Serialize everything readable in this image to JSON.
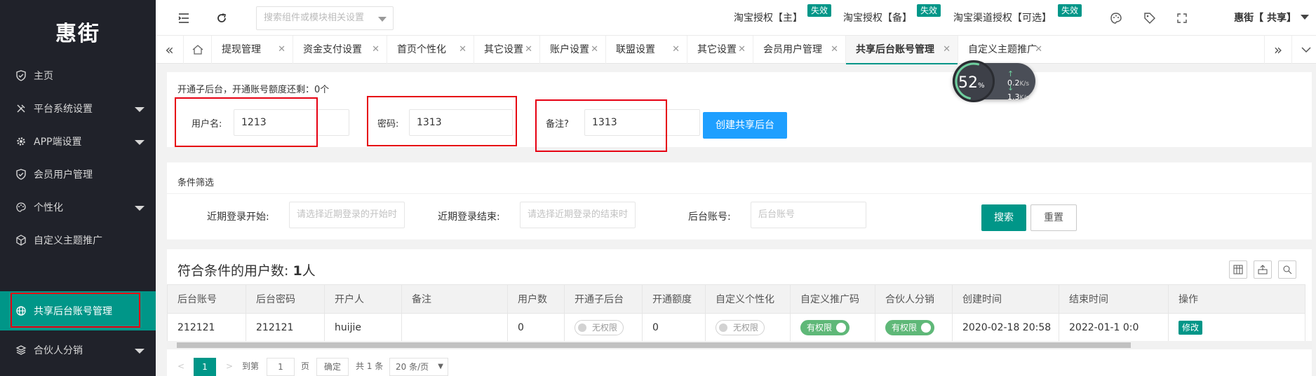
{
  "app": {
    "logo": "惠街"
  },
  "sidebar": {
    "items": [
      {
        "label": "主页",
        "icon": "shield-icon",
        "has_caret": false
      },
      {
        "label": "平台系统设置",
        "icon": "tools-icon",
        "has_caret": true
      },
      {
        "label": "APP端设置",
        "icon": "gear-icon",
        "has_caret": true
      },
      {
        "label": "会员用户管理",
        "icon": "shield-icon",
        "has_caret": false
      },
      {
        "label": "个性化",
        "icon": "palette-icon",
        "has_caret": true
      },
      {
        "label": "自定义主题推广",
        "icon": "cube-icon",
        "has_caret": false
      },
      {
        "label": "共享后台账号管理",
        "icon": "globe-icon",
        "has_caret": false,
        "active": true
      },
      {
        "label": "合伙人分销",
        "icon": "layers-icon",
        "has_caret": true
      }
    ]
  },
  "header": {
    "search_placeholder": "搜索组件或模块相关设置",
    "auth_main": "淘宝授权【主】",
    "auth_main_badge": "失效",
    "auth_backup": "淘宝授权【备】",
    "auth_backup_badge": "失效",
    "auth_channel": "淘宝渠道授权【可选】",
    "auth_channel_badge": "失效",
    "user": "惠街【 共享】"
  },
  "tabs": [
    "提现管理",
    "资金支付设置",
    "首页个性化",
    "其它设置",
    "账户设置",
    "联盟设置",
    "其它设置",
    "会员用户管理",
    "共享后台账号管理",
    "自定义主题推广"
  ],
  "create_form": {
    "notice": "开通子后台，开通账号额度还剩：0个",
    "username_label": "用户名:",
    "username_value": "1213",
    "password_label": "密码:",
    "password_value": "1313",
    "remark_label": "备注?",
    "remark_value": "1313",
    "create_button": "创建共享后台"
  },
  "filter": {
    "title": "条件筛选",
    "login_start_label": "近期登录开始:",
    "login_start_placeholder": "请选择近期登录的开始时",
    "login_end_label": "近期登录结束:",
    "login_end_placeholder": "请选择近期登录的结束时",
    "account_label": "后台账号:",
    "account_placeholder": "后台账号",
    "search_button": "搜索",
    "reset_button": "重置"
  },
  "result": {
    "count_prefix": "符合条件的用户数:",
    "count": "1",
    "count_suffix": "人"
  },
  "table": {
    "columns": [
      "后台账号",
      "后台密码",
      "开户人",
      "备注",
      "用户数",
      "开通子后台",
      "开通额度",
      "自定义个性化",
      "自定义推广码",
      "合伙人分销",
      "创建时间",
      "结束时间",
      "操作"
    ],
    "rows": [
      {
        "account": "212121",
        "password": "212121",
        "owner": "huijie",
        "remark": "",
        "users": "0",
        "sub_admin": "无权限",
        "quota": "0",
        "custom_style": "无权限",
        "promo_code": "有权限",
        "partner": "有权限",
        "created": "2020-02-18 20:58",
        "ends": "2022-01-1 0:0",
        "action": "修改"
      }
    ]
  },
  "pager": {
    "current": "1",
    "goto_label": "到第",
    "goto_value": "1",
    "page_unit": "页",
    "confirm": "确定",
    "total": "共 1 条",
    "page_size": "20 条/页"
  },
  "speed_widget": {
    "percent": "52",
    "percent_unit": "%",
    "up": "0.2",
    "up_unit": "K/s",
    "down": "1.3",
    "down_unit": "K/s"
  },
  "colors": {
    "accent": "#009688",
    "sidebar_bg": "#20222a",
    "blue": "#1e9fff",
    "highlight": "#e60012"
  }
}
